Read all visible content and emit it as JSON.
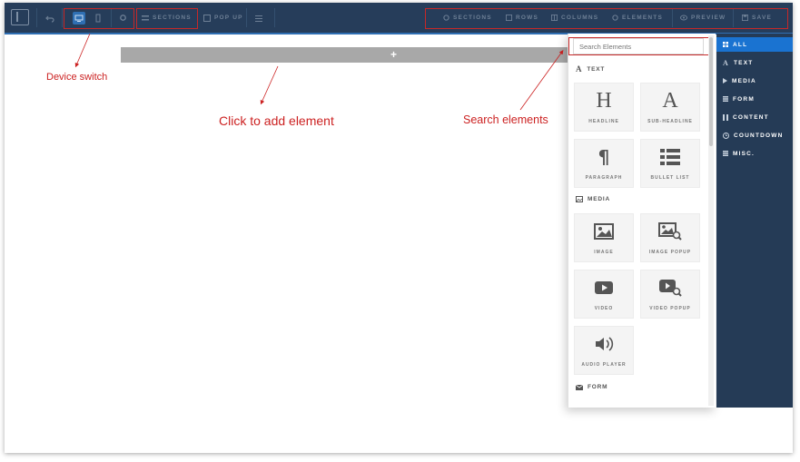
{
  "toolbar": {
    "left_items": [
      {
        "label": "SECTIONS",
        "icon": "sections-icon"
      },
      {
        "label": "POP UP",
        "icon": "popup-icon"
      }
    ],
    "right_items": [
      {
        "label": "SECTIONS",
        "icon": "sections-icon"
      },
      {
        "label": "ROWS",
        "icon": "rows-icon"
      },
      {
        "label": "COLUMNS",
        "icon": "columns-icon"
      },
      {
        "label": "ELEMENTS",
        "icon": "elements-icon"
      },
      {
        "label": "PREVIEW",
        "icon": "eye-icon"
      },
      {
        "label": "SAVE",
        "icon": "save-icon"
      }
    ],
    "colors": {
      "background": "#263d5a",
      "accent": "#2f6fb3",
      "muted_text": "#6d7f95"
    }
  },
  "canvas": {
    "add_row_symbol": "+"
  },
  "annotations": {
    "device_switch": "Device switch",
    "click_to_add": "Click to add element",
    "search_elements": "Search elements",
    "color": "#cc2222"
  },
  "element_panel": {
    "search_placeholder": "Search Elements",
    "sections": [
      {
        "title": "TEXT",
        "icon": "text-a-icon",
        "items": [
          {
            "label": "HEADLINE",
            "icon": "headline-h-icon"
          },
          {
            "label": "SUB-HEADLINE",
            "icon": "subheadline-a-icon"
          },
          {
            "label": "PARAGRAPH",
            "icon": "pilcrow-icon"
          },
          {
            "label": "BULLET LIST",
            "icon": "bullet-list-icon"
          }
        ]
      },
      {
        "title": "MEDIA",
        "icon": "image-icon",
        "items": [
          {
            "label": "IMAGE",
            "icon": "image-icon"
          },
          {
            "label": "IMAGE POPUP",
            "icon": "image-search-icon"
          },
          {
            "label": "VIDEO",
            "icon": "play-icon"
          },
          {
            "label": "VIDEO POPUP",
            "icon": "video-search-icon"
          },
          {
            "label": "AUDIO PLAYER",
            "icon": "speaker-icon"
          }
        ]
      },
      {
        "title": "FORM",
        "icon": "envelope-icon",
        "items": []
      }
    ]
  },
  "categories": [
    {
      "label": "ALL",
      "icon": "grid-icon",
      "active": true
    },
    {
      "label": "TEXT",
      "icon": "text-a-icon",
      "active": false
    },
    {
      "label": "MEDIA",
      "icon": "play-small-icon",
      "active": false
    },
    {
      "label": "FORM",
      "icon": "form-icon",
      "active": false
    },
    {
      "label": "CONTENT",
      "icon": "content-icon",
      "active": false
    },
    {
      "label": "COUNTDOWN",
      "icon": "clock-icon",
      "active": false
    },
    {
      "label": "MISC.",
      "icon": "misc-icon",
      "active": false
    }
  ],
  "category_colors": {
    "background": "#253b56",
    "active": "#1a73d1"
  }
}
